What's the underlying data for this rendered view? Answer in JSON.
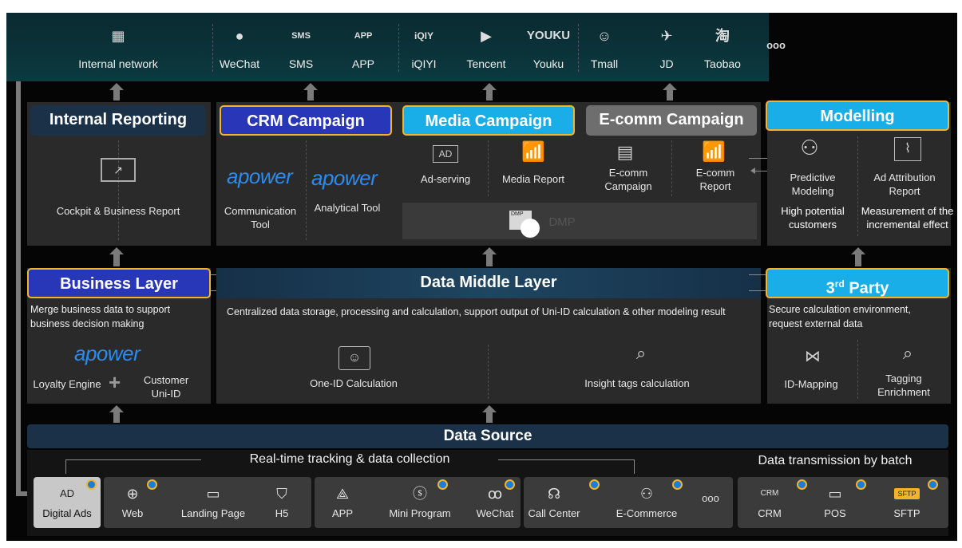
{
  "top_channels": [
    {
      "label": "Internal network",
      "icon": "building-icon",
      "glyph": "▦"
    },
    {
      "label": "WeChat",
      "icon": "wechat-icon",
      "glyph": "●"
    },
    {
      "label": "SMS",
      "icon": "sms-icon",
      "glyph": "SMS"
    },
    {
      "label": "APP",
      "icon": "app-icon",
      "glyph": "APP"
    },
    {
      "label": "iQIYI",
      "icon": "iqiyi-icon",
      "glyph": "iQIY"
    },
    {
      "label": "Tencent",
      "icon": "tencent-icon",
      "glyph": "▶"
    },
    {
      "label": "Youku",
      "icon": "youku-icon",
      "glyph": "YOUKU"
    },
    {
      "label": "Tmall",
      "icon": "tmall-icon",
      "glyph": "☺"
    },
    {
      "label": "JD",
      "icon": "jd-icon",
      "glyph": "✈"
    },
    {
      "label": "Taobao",
      "icon": "taobao-icon",
      "glyph": "淘"
    }
  ],
  "top_more": "ooo",
  "internal_reporting": {
    "title": "Internal Reporting",
    "item": "Cockpit & Business Report"
  },
  "crm_campaign": {
    "title": "CRM Campaign",
    "brand": "apower",
    "items": [
      "Communication Tool",
      "Analytical Tool"
    ]
  },
  "media_campaign": {
    "title": "Media Campaign",
    "items": [
      "Ad-serving",
      "Media Report"
    ],
    "dmp": "DMP",
    "ad_glyph": "AD"
  },
  "ecomm_campaign": {
    "title": "E-comm Campaign",
    "items": [
      "E-comm Campaign",
      "E-comm Report"
    ]
  },
  "modelling": {
    "title": "Modelling",
    "items": [
      "Predictive Modeling",
      "Ad Attribution Report"
    ],
    "subtexts": [
      "High potential customers",
      "Measurement of the incremental effect"
    ]
  },
  "business_layer": {
    "title": "Business Layer",
    "desc": "Merge business data to support business decision making",
    "brand": "apower",
    "items": [
      "Loyalty Engine",
      "Customer Uni-ID"
    ]
  },
  "data_middle_layer": {
    "title": "Data Middle Layer",
    "desc": "Centralized data storage, processing and calculation, support output of Uni-ID calculation & other modeling result",
    "items": [
      "One-ID Calculation",
      "Insight tags calculation"
    ]
  },
  "third_party": {
    "title_main": "3",
    "title_sup": "rd",
    "title_rest": " Party",
    "desc": "Secure calculation environment, request external data",
    "items": [
      "ID-Mapping",
      "Tagging Enrichment"
    ]
  },
  "data_source": {
    "title": "Data Source",
    "realtime_label": "Real-time tracking & data collection",
    "batch_label": "Data transmission by batch",
    "sources": [
      {
        "label": "Digital Ads",
        "icon": "ad-icon",
        "glyph": "AD"
      },
      {
        "label": "Web",
        "icon": "globe-icon",
        "glyph": "⊕"
      },
      {
        "label": "Landing Page",
        "icon": "landing-page-icon",
        "glyph": "▭"
      },
      {
        "label": "H5",
        "icon": "h5-icon",
        "glyph": "⛉"
      },
      {
        "label": "APP",
        "icon": "app-store-icon",
        "glyph": "⟁"
      },
      {
        "label": "Mini Program",
        "icon": "mini-program-icon",
        "glyph": "ⓢ"
      },
      {
        "label": "WeChat",
        "icon": "wechat-icon",
        "glyph": "ꝏ"
      },
      {
        "label": "Call Center",
        "icon": "headset-icon",
        "glyph": "☊"
      },
      {
        "label": "E-Commerce",
        "icon": "shop-bot-icon",
        "glyph": "⚇"
      },
      {
        "label": "CRM",
        "icon": "crm-icon",
        "glyph": "CRM"
      },
      {
        "label": "POS",
        "icon": "pos-icon",
        "glyph": "▭"
      },
      {
        "label": "SFTP",
        "icon": "sftp-folder-icon",
        "glyph": "SFTP"
      }
    ],
    "more": "ooo"
  }
}
